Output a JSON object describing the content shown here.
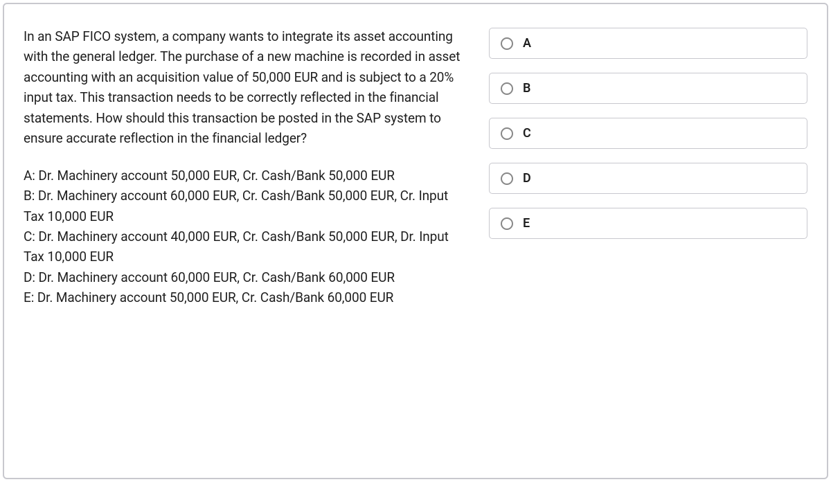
{
  "question": "In an SAP FICO system, a company wants to integrate its asset accounting with the general ledger. The purchase of a new machine is recorded in asset accounting with an acquisition value of 50,000 EUR and is subject to a 20% input tax. This transaction needs to be correctly reflected in the financial statements. How should this transaction be posted in the SAP system to ensure accurate reflection in the financial ledger?",
  "answers": {
    "a": "A: Dr. Machinery account 50,000 EUR, Cr. Cash/Bank 50,000 EUR",
    "b": "B: Dr. Machinery account 60,000 EUR, Cr. Cash/Bank 50,000 EUR, Cr. Input Tax 10,000 EUR",
    "c": "C: Dr. Machinery account 40,000 EUR, Cr. Cash/Bank 50,000 EUR, Dr. Input Tax 10,000 EUR",
    "d": "D: Dr. Machinery account 60,000 EUR, Cr. Cash/Bank 60,000 EUR",
    "e": "E: Dr. Machinery account 50,000 EUR, Cr. Cash/Bank 60,000 EUR"
  },
  "options": {
    "a": "A",
    "b": "B",
    "c": "C",
    "d": "D",
    "e": "E"
  }
}
